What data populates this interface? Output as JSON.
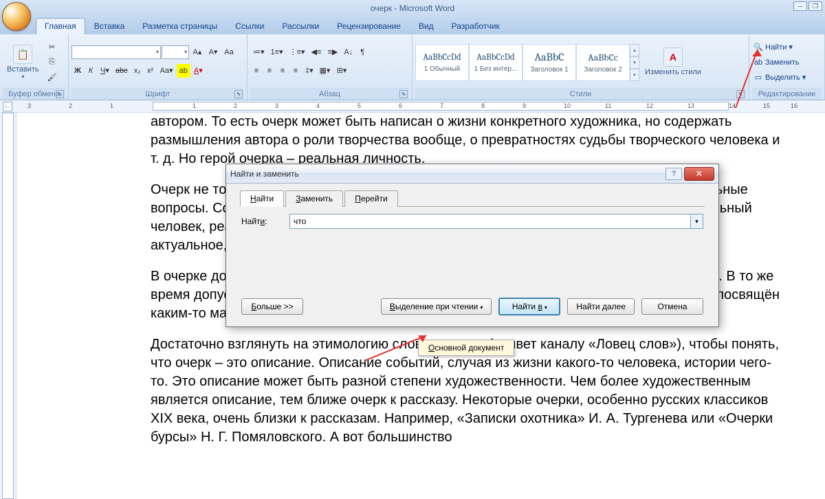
{
  "title": "очерк - Microsoft Word",
  "tabs": {
    "home": "Главная",
    "insert": "Вставка",
    "layout": "Разметка страницы",
    "refs": "Ссылки",
    "mail": "Рассылки",
    "review": "Рецензирование",
    "view": "Вид",
    "dev": "Разработчик"
  },
  "ribbon": {
    "paste": "Вставить",
    "clipboard": "Буфер обмена",
    "font": "Шрифт",
    "paragraph": "Абзац",
    "styles_label": "Стили",
    "change_styles": "Изменить стили",
    "editing": "Редактирование",
    "find": "Найти",
    "replace": "Заменить",
    "select": "Выделить",
    "styles": [
      {
        "preview": "AaBbCcDd",
        "name": "1 Обычный"
      },
      {
        "preview": "AaBbCcDd",
        "name": "1 Без интер..."
      },
      {
        "preview": "AaBbC",
        "name": "Заголовок 1"
      },
      {
        "preview": "AaBbCc",
        "name": "Заголовок 2"
      }
    ]
  },
  "ruler": [
    "3",
    "2",
    "1",
    "1",
    "2",
    "3",
    "4",
    "5",
    "6",
    "7",
    "8",
    "9",
    "10",
    "11",
    "12",
    "13",
    "14",
    "15",
    "16",
    "17"
  ],
  "document": {
    "p1": "автором.   То есть очерк может быть написан о жизни конкретного художника, но содержать размышления автора о роли творчества вообще, о превратностях судьбы творческого человека и т. д. Но герой очерка – реальная личность.",
    "p2": "Очерк не только описывает реальность, нередко автор в нём поднимает острые социальные вопросы. Собственно, так было изначально. Но на первом месте всегда находился реальный человек, реальная ситуация, а не просто повод для рассуждения. Для статьи главное – актуальное, красивое, для очерка – реальное.",
    "p3": "В очерке допускается авторский вымысел, но только в деталях, а не в реальных данных. В то же время допускается некое обобщение, очерк может не иметь конкретного героя, если он посвящён каким-то масштабным событиям.",
    "p4": "Достаточно взглянуть на этимологию слова «очерк» (привет каналу «Ловец слов»), чтобы понять, что очерк – это описание. Описание событий, случая из жизни какого-то человека, истории чего-то. Это описание может быть разной степени художественности. Чем более художественным является описание, тем ближе очерк к рассказу. Некоторые очерки, особенно русских классиков XIX века, очень близки к рассказам. Например, «Записки охотника» И. А. Тургенева или «Очерки бурсы» Н. Г. Помяловского. А вот большинство"
  },
  "dialog": {
    "title": "Найти и заменить",
    "tabs": {
      "find": "Найти",
      "replace": "Заменить",
      "goto": "Перейти"
    },
    "find_label": "Найти:",
    "find_value": "что",
    "more": "Больше >>",
    "reading_highlight": "Выделение при чтении",
    "find_in": "Найти в",
    "find_next": "Найти далее",
    "cancel": "Отмена",
    "menu_item": "Основной документ"
  }
}
